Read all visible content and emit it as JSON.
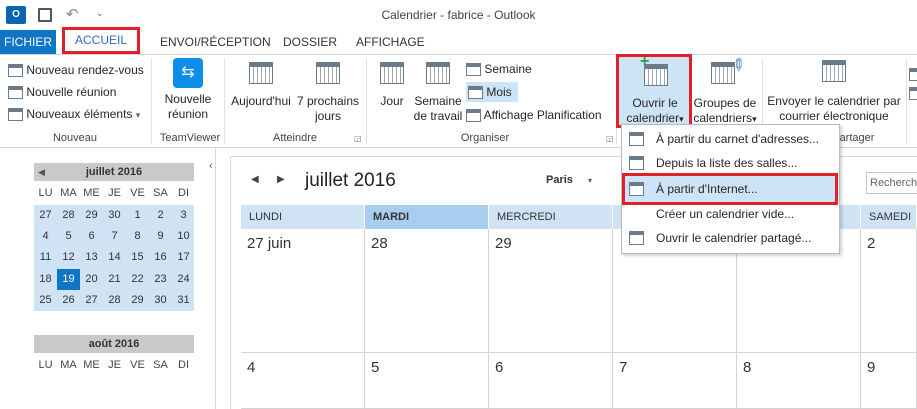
{
  "window": {
    "title": "Calendrier - fabrice - Outlook",
    "app_icon": "O",
    "undo_icon": "undo-icon",
    "more_icon": "qat-more-icon"
  },
  "tabs": [
    "FICHIER",
    "ACCUEIL",
    "ENVOI/RÉCEPTION",
    "DOSSIER",
    "AFFICHAGE"
  ],
  "ribbon": {
    "nouveau": {
      "items": [
        "Nouveau rendez-vous",
        "Nouvelle réunion",
        "Nouveaux éléments"
      ],
      "label": "Nouveau",
      "dropdown_icon": "▾"
    },
    "teamviewer": {
      "button": [
        "Nouvelle",
        "réunion"
      ],
      "label": "TeamViewer"
    },
    "atteindre": {
      "aujourdhui": "Aujourd'hui",
      "prochains": [
        "7 prochains",
        "jours"
      ],
      "label": "Atteindre"
    },
    "organiser": {
      "jour": "Jour",
      "semaine_travail": [
        "Semaine",
        "de travail"
      ],
      "semaine": "Semaine",
      "mois": "Mois",
      "planification": "Affichage Planification",
      "label": "Organiser"
    },
    "ouvrir": {
      "label_lines": [
        "Ouvrir le",
        "calendrier"
      ],
      "dropdown": "▾"
    },
    "groupes": {
      "label_lines": [
        "Groupes de",
        "calendriers"
      ],
      "dropdown": "▾"
    },
    "envoyer": {
      "label_lines": [
        "Envoyer le calendrier par",
        "courrier électronique"
      ]
    },
    "partager_label_partial": "artager"
  },
  "dropdown_menu": [
    "À partir du carnet d'adresses...",
    "Depuis la liste des salles...",
    "À partir d'Internet...",
    "Créer un calendrier vide...",
    "Ouvrir le calendrier partagé..."
  ],
  "mini_cal": {
    "month1": "juillet 2016",
    "month2": "août 2016",
    "dow": [
      "LU",
      "MA",
      "ME",
      "JE",
      "VE",
      "SA",
      "DI"
    ],
    "weeks": [
      [
        "27",
        "28",
        "29",
        "30",
        "1",
        "2",
        "3"
      ],
      [
        "4",
        "5",
        "6",
        "7",
        "8",
        "9",
        "10"
      ],
      [
        "11",
        "12",
        "13",
        "14",
        "15",
        "16",
        "17"
      ],
      [
        "18",
        "19",
        "20",
        "21",
        "22",
        "23",
        "24"
      ],
      [
        "25",
        "26",
        "27",
        "28",
        "29",
        "30",
        "31"
      ]
    ],
    "today": "19"
  },
  "calendar": {
    "month_title": "juillet 2016",
    "location": "Paris",
    "search_placeholder": "Recherch",
    "dow": [
      "LUNDI",
      "MARDI",
      "MERCREDI",
      "",
      "",
      "SAMEDI"
    ],
    "row1": [
      "27 juin",
      "28",
      "29",
      "",
      "",
      "2"
    ],
    "row2": [
      "4",
      "5",
      "6",
      "7",
      "8",
      "9"
    ]
  },
  "colors": {
    "accent": "#0f75c6",
    "highlight": "#cde4f7",
    "callout": "#e0202a"
  }
}
